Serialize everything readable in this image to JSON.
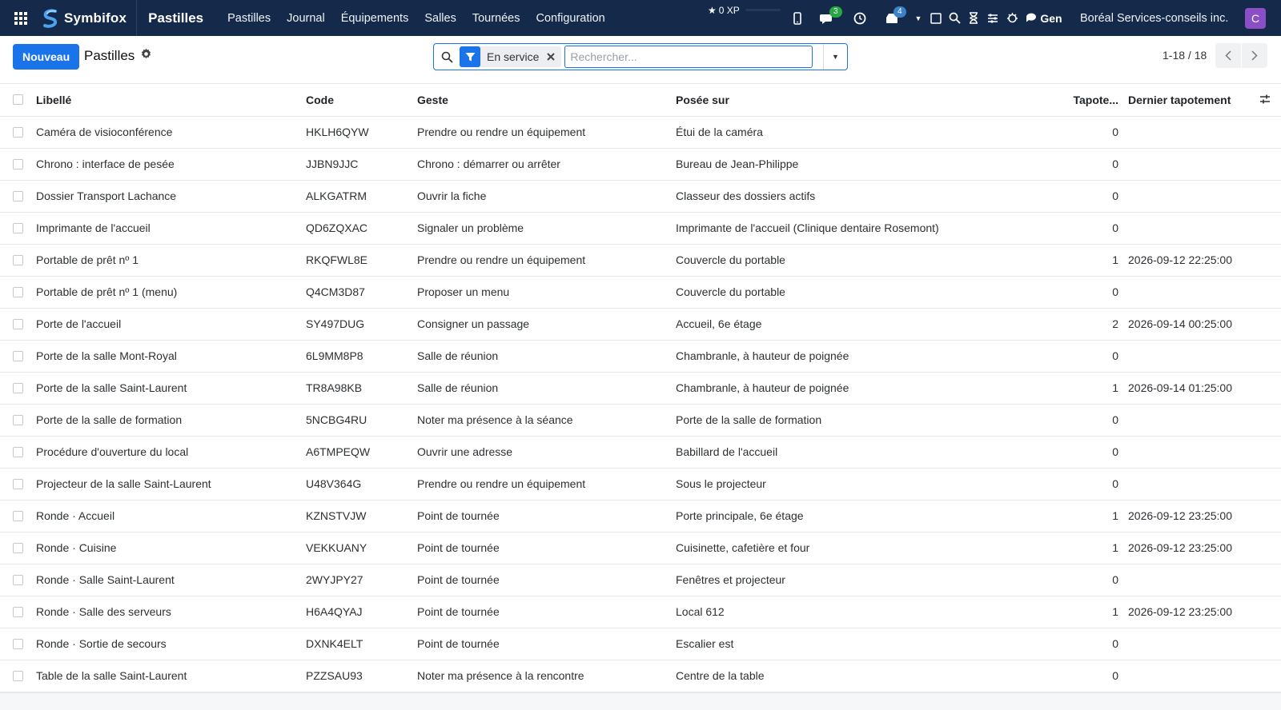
{
  "navbar": {
    "brand": "Symbifox",
    "app_title": "Pastilles",
    "menu": [
      "Pastilles",
      "Journal",
      "Équipements",
      "Salles",
      "Tournées",
      "Configuration"
    ],
    "xp": "0 XP",
    "messages_count": "3",
    "activities_count": "4",
    "gen_label": "Gen",
    "company": "Boréal Services-conseils inc.",
    "avatar_letter": "C",
    "colors": {
      "bar": "#152a4a",
      "avatar": "#8a4fc7",
      "badge_messages": "#28a745",
      "badge_activities": "#3b82c4"
    }
  },
  "control_panel": {
    "new_button": "Nouveau",
    "breadcrumb": "Pastilles",
    "search": {
      "facet": "En service",
      "placeholder": "Rechercher..."
    },
    "pager": "1-18 / 18"
  },
  "table": {
    "headers": {
      "name": "Libellé",
      "code": "Code",
      "geste": "Geste",
      "posee": "Posée sur",
      "taps": "Tapote...",
      "last": "Dernier tapotement"
    },
    "rows": [
      {
        "name": "Caméra de visioconférence",
        "code": "HKLH6QYW",
        "geste": "Prendre ou rendre un équipement",
        "posee": "Étui de la caméra",
        "taps": "0",
        "last": ""
      },
      {
        "name": "Chrono : interface de pesée",
        "code": "JJBN9JJC",
        "geste": "Chrono : démarrer ou arrêter",
        "posee": "Bureau de Jean-Philippe",
        "taps": "0",
        "last": ""
      },
      {
        "name": "Dossier Transport Lachance",
        "code": "ALKGATRM",
        "geste": "Ouvrir la fiche",
        "posee": "Classeur des dossiers actifs",
        "taps": "0",
        "last": ""
      },
      {
        "name": "Imprimante de l'accueil",
        "code": "QD6ZQXAC",
        "geste": "Signaler un problème",
        "posee": "Imprimante de l'accueil (Clinique dentaire Rosemont)",
        "taps": "0",
        "last": ""
      },
      {
        "name": "Portable de prêt nº 1",
        "code": "RKQFWL8E",
        "geste": "Prendre ou rendre un équipement",
        "posee": "Couvercle du portable",
        "taps": "1",
        "last": "2026-09-12 22:25:00"
      },
      {
        "name": "Portable de prêt nº 1 (menu)",
        "code": "Q4CM3D87",
        "geste": "Proposer un menu",
        "posee": "Couvercle du portable",
        "taps": "0",
        "last": ""
      },
      {
        "name": "Porte de l'accueil",
        "code": "SY497DUG",
        "geste": "Consigner un passage",
        "posee": "Accueil, 6e étage",
        "taps": "2",
        "last": "2026-09-14 00:25:00"
      },
      {
        "name": "Porte de la salle Mont-Royal",
        "code": "6L9MM8P8",
        "geste": "Salle de réunion",
        "posee": "Chambranle, à hauteur de poignée",
        "taps": "0",
        "last": ""
      },
      {
        "name": "Porte de la salle Saint-Laurent",
        "code": "TR8A98KB",
        "geste": "Salle de réunion",
        "posee": "Chambranle, à hauteur de poignée",
        "taps": "1",
        "last": "2026-09-14 01:25:00"
      },
      {
        "name": "Porte de la salle de formation",
        "code": "5NCBG4RU",
        "geste": "Noter ma présence à la séance",
        "posee": "Porte de la salle de formation",
        "taps": "0",
        "last": ""
      },
      {
        "name": "Procédure d'ouverture du local",
        "code": "A6TMPEQW",
        "geste": "Ouvrir une adresse",
        "posee": "Babillard de l'accueil",
        "taps": "0",
        "last": ""
      },
      {
        "name": "Projecteur de la salle Saint-Laurent",
        "code": "U48V364G",
        "geste": "Prendre ou rendre un équipement",
        "posee": "Sous le projecteur",
        "taps": "0",
        "last": ""
      },
      {
        "name": "Ronde · Accueil",
        "code": "KZNSTVJW",
        "geste": "Point de tournée",
        "posee": "Porte principale, 6e étage",
        "taps": "1",
        "last": "2026-09-12 23:25:00"
      },
      {
        "name": "Ronde · Cuisine",
        "code": "VEKKUANY",
        "geste": "Point de tournée",
        "posee": "Cuisinette, cafetière et four",
        "taps": "1",
        "last": "2026-09-12 23:25:00"
      },
      {
        "name": "Ronde · Salle Saint-Laurent",
        "code": "2WYJPY27",
        "geste": "Point de tournée",
        "posee": "Fenêtres et projecteur",
        "taps": "0",
        "last": ""
      },
      {
        "name": "Ronde · Salle des serveurs",
        "code": "H6A4QYAJ",
        "geste": "Point de tournée",
        "posee": "Local 612",
        "taps": "1",
        "last": "2026-09-12 23:25:00"
      },
      {
        "name": "Ronde · Sortie de secours",
        "code": "DXNK4ELT",
        "geste": "Point de tournée",
        "posee": "Escalier est",
        "taps": "0",
        "last": ""
      },
      {
        "name": "Table de la salle Saint-Laurent",
        "code": "PZZSAU93",
        "geste": "Noter ma présence à la rencontre",
        "posee": "Centre de la table",
        "taps": "0",
        "last": ""
      }
    ]
  }
}
